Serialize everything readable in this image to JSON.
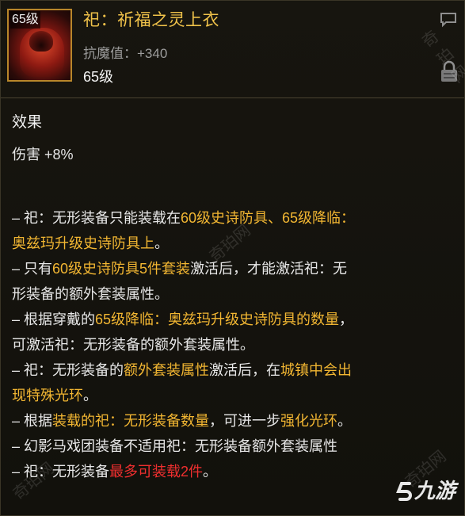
{
  "item": {
    "icon_level": "65级",
    "name": "祀：祈福之灵上衣",
    "stat": "抗魔值：+340",
    "level": "65级"
  },
  "effect": {
    "title": "效果",
    "value": "伤害 +8%"
  },
  "description": [
    [
      {
        "t": "– 祀：无形装备只能装载在",
        "c": ""
      },
      {
        "t": "60级史诗防具、65级降临：",
        "c": "y"
      }
    ],
    [
      {
        "t": "奥兹玛升级史诗防具上",
        "c": "y"
      },
      {
        "t": "。",
        "c": ""
      }
    ],
    [
      {
        "t": "– 只有",
        "c": ""
      },
      {
        "t": "60级史诗防具5件套装",
        "c": "y"
      },
      {
        "t": "激活后，才能激活祀：无",
        "c": ""
      }
    ],
    [
      {
        "t": "形装备的额外套装属性。",
        "c": ""
      }
    ],
    [
      {
        "t": "– 根据穿戴的",
        "c": ""
      },
      {
        "t": "65级降临：奥兹玛升级史诗防具的数量",
        "c": "y"
      },
      {
        "t": "，",
        "c": ""
      }
    ],
    [
      {
        "t": "可激活祀：无形装备的额外套装属性。",
        "c": ""
      }
    ],
    [
      {
        "t": "– 祀：无形装备的",
        "c": ""
      },
      {
        "t": "额外套装属性",
        "c": "y"
      },
      {
        "t": "激活后，在",
        "c": ""
      },
      {
        "t": "城镇中会出",
        "c": "y"
      }
    ],
    [
      {
        "t": "现特殊光环",
        "c": "y"
      },
      {
        "t": "。",
        "c": ""
      }
    ],
    [
      {
        "t": "– 根据",
        "c": ""
      },
      {
        "t": "装载的祀：无形装备数量",
        "c": "y"
      },
      {
        "t": "，可进一步",
        "c": ""
      },
      {
        "t": "强化光环",
        "c": "y"
      },
      {
        "t": "。",
        "c": ""
      }
    ],
    [
      {
        "t": "– 幻影马戏团装备不适用祀：无形装备额外套装属性",
        "c": ""
      }
    ],
    [
      {
        "t": "– 祀：无形装备",
        "c": ""
      },
      {
        "t": "最多可装载2件",
        "c": "r"
      },
      {
        "t": "。",
        "c": ""
      }
    ]
  ],
  "watermarks": [
    "奇珀网",
    "奇珀网",
    "奇珀网",
    "奇珀网"
  ],
  "logo": "九游",
  "colors": {
    "name": "#f0c24a",
    "highlight": "#f2b632",
    "warning": "#ef2f2f",
    "frame": "#b8862a"
  }
}
